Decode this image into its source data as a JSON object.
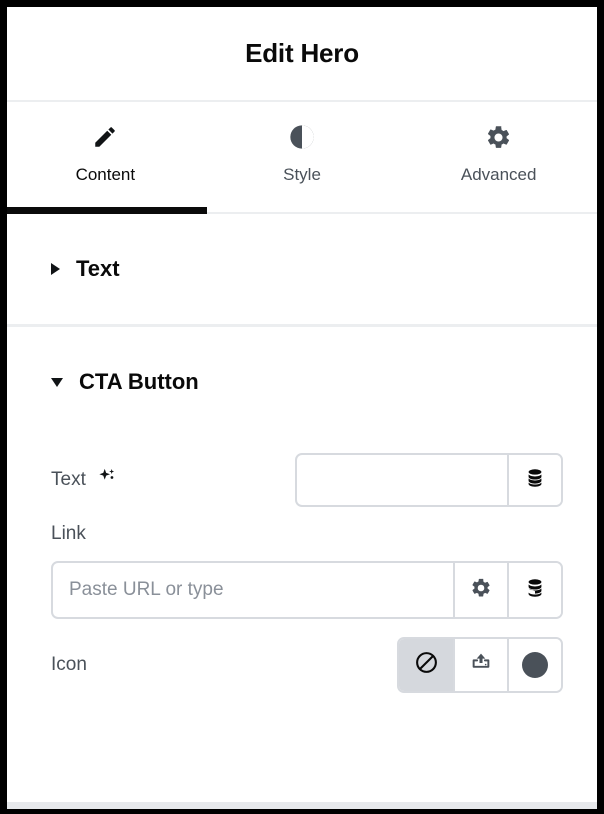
{
  "window": {
    "title": "Edit Hero"
  },
  "tabs": [
    {
      "label": "Content",
      "icon": "pencil-icon",
      "active": true
    },
    {
      "label": "Style",
      "icon": "contrast-icon",
      "active": false
    },
    {
      "label": "Advanced",
      "icon": "gear-icon",
      "active": false
    }
  ],
  "sections": [
    {
      "title": "Text",
      "expanded": false,
      "caret": "chevron-right-icon"
    },
    {
      "title": "CTA Button",
      "expanded": true,
      "caret": "chevron-down-icon"
    }
  ],
  "cta_button": {
    "text_field": {
      "label": "Text",
      "ai_icon": "sparkles-icon",
      "value": "",
      "placeholder": "",
      "data_button_icon": "database-icon"
    },
    "link_field": {
      "label": "Link",
      "value": "",
      "placeholder": "Paste URL or type",
      "settings_button_icon": "gear-icon",
      "data_button_icon": "database-icon"
    },
    "icon_field": {
      "label": "Icon",
      "options": [
        {
          "name": "none",
          "icon": "circle-slash-icon",
          "selected": true
        },
        {
          "name": "upload",
          "icon": "upload-icon",
          "selected": false
        },
        {
          "name": "shape",
          "icon": "filled-circle-icon",
          "selected": false
        }
      ]
    }
  },
  "colors": {
    "accent": "#0a0a0a",
    "label": "#4a5159",
    "border": "#d7dadf",
    "divider": "#eceef0",
    "selected_bg": "#d5d8dd",
    "placeholder": "#8a9099"
  }
}
